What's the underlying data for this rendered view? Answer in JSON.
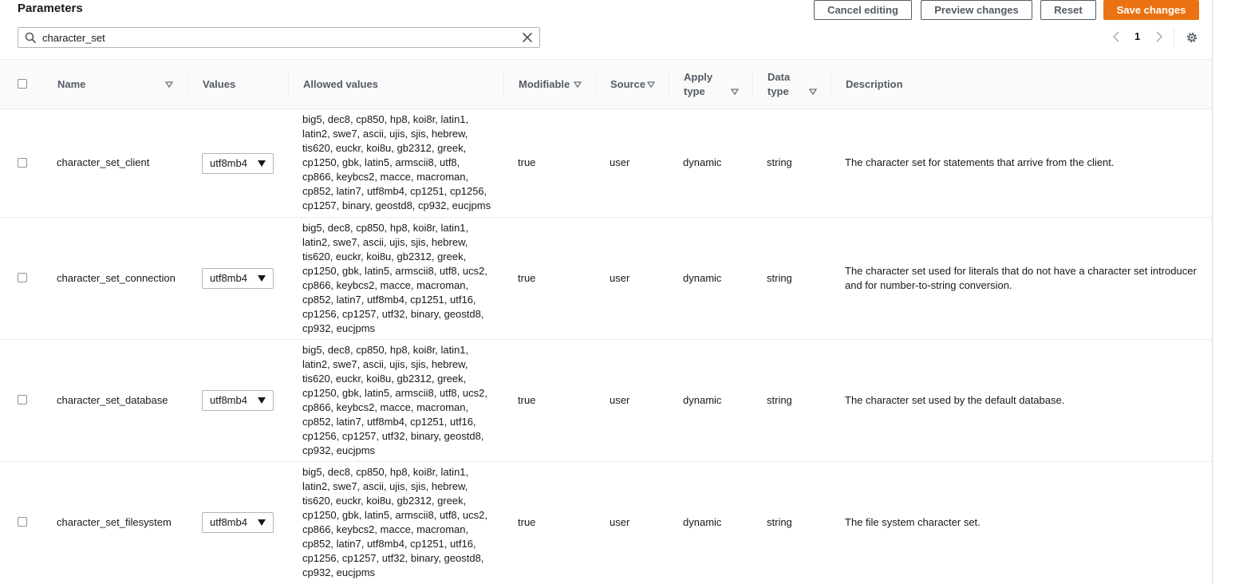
{
  "header": {
    "title": "Parameters",
    "buttons": {
      "cancel": "Cancel editing",
      "preview": "Preview changes",
      "reset": "Reset",
      "save": "Save changes"
    }
  },
  "search": {
    "value": "character_set",
    "placeholder": ""
  },
  "pagination": {
    "current_page": "1"
  },
  "table": {
    "columns": {
      "name": "Name",
      "values": "Values",
      "allowed": "Allowed values",
      "modifiable": "Modifiable",
      "source": "Source",
      "apply_type_1": "Apply",
      "apply_type_2": "type",
      "data_type_1": "Data",
      "data_type_2": "type",
      "description": "Description"
    },
    "rows": [
      {
        "name": "character_set_client",
        "value": "utf8mb4",
        "allowed_lines": [
          "big5, dec8, cp850, hp8, koi8r, latin1,",
          "latin2, swe7, ascii, ujis, sjis, hebrew,",
          "tis620, euckr, koi8u, gb2312, greek,",
          "cp1250, gbk, latin5, armscii8, utf8,",
          "cp866, keybcs2, macce, macroman,",
          "cp852, latin7, utf8mb4, cp1251, cp1256,",
          "cp1257, binary, geostd8, cp932, eucjpms"
        ],
        "modifiable": "true",
        "source": "user",
        "apply_type": "dynamic",
        "data_type": "string",
        "description_lines": [
          "The character set for statements that arrive from the client."
        ]
      },
      {
        "name": "character_set_connection",
        "value": "utf8mb4",
        "allowed_lines": [
          "big5, dec8, cp850, hp8, koi8r, latin1,",
          "latin2, swe7, ascii, ujis, sjis, hebrew,",
          "tis620, euckr, koi8u, gb2312, greek,",
          "cp1250, gbk, latin5, armscii8, utf8, ucs2,",
          "cp866, keybcs2, macce, macroman,",
          "cp852, latin7, utf8mb4, cp1251, utf16,",
          "cp1256, cp1257, utf32, binary, geostd8,",
          "cp932, eucjpms"
        ],
        "modifiable": "true",
        "source": "user",
        "apply_type": "dynamic",
        "data_type": "string",
        "description_lines": [
          "The character set used for literals that do not have a character set introducer",
          "and for number-to-string conversion."
        ]
      },
      {
        "name": "character_set_database",
        "value": "utf8mb4",
        "allowed_lines": [
          "big5, dec8, cp850, hp8, koi8r, latin1,",
          "latin2, swe7, ascii, ujis, sjis, hebrew,",
          "tis620, euckr, koi8u, gb2312, greek,",
          "cp1250, gbk, latin5, armscii8, utf8, ucs2,",
          "cp866, keybcs2, macce, macroman,",
          "cp852, latin7, utf8mb4, cp1251, utf16,",
          "cp1256, cp1257, utf32, binary, geostd8,",
          "cp932, eucjpms"
        ],
        "modifiable": "true",
        "source": "user",
        "apply_type": "dynamic",
        "data_type": "string",
        "description_lines": [
          "The character set used by the default database."
        ]
      },
      {
        "name": "character_set_filesystem",
        "value": "utf8mb4",
        "allowed_lines": [
          "big5, dec8, cp850, hp8, koi8r, latin1,",
          "latin2, swe7, ascii, ujis, sjis, hebrew,",
          "tis620, euckr, koi8u, gb2312, greek,",
          "cp1250, gbk, latin5, armscii8, utf8, ucs2,",
          "cp866, keybcs2, macce, macroman,",
          "cp852, latin7, utf8mb4, cp1251, utf16,",
          "cp1256, cp1257, utf32, binary, geostd8,",
          "cp932, eucjpms"
        ],
        "modifiable": "true",
        "source": "user",
        "apply_type": "dynamic",
        "data_type": "string",
        "description_lines": [
          "The file system character set."
        ]
      }
    ]
  }
}
